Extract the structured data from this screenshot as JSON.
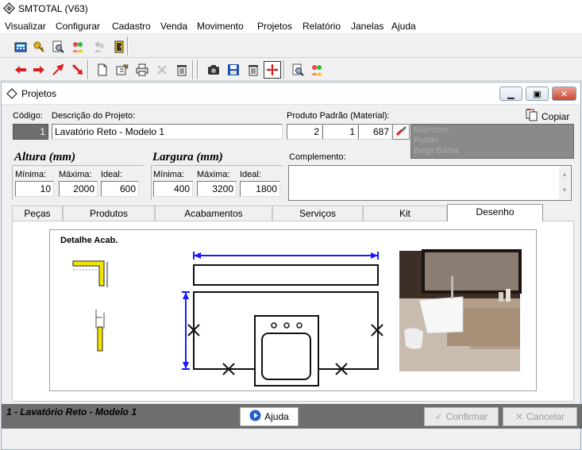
{
  "app": {
    "title": "SMTOTAL (V63)"
  },
  "menu": [
    "Visualizar",
    "Configurar",
    "Cadastro",
    "Venda",
    "Movimento",
    "Projetos",
    "Relatório",
    "Janelas",
    "Ajuda"
  ],
  "window": {
    "title": "Projetos"
  },
  "form": {
    "codigo_label": "Código:",
    "codigo_value": "1",
    "descricao_label": "Descrição do Projeto:",
    "descricao_value": "Lavatório Reto - Modelo 1",
    "produto_label": "Produto Padrão (Material):",
    "produto_v1": "2",
    "produto_v2": "1",
    "produto_v3": "687",
    "copiar_label": "Copiar",
    "materials": [
      "Mármore",
      "Polido",
      "Bege Bahia"
    ],
    "altura_title": "Altura (mm)",
    "largura_title": "Largura (mm)",
    "minima_label": "Mínima:",
    "maxima_label": "Máxima:",
    "ideal_label": "Ideal:",
    "altura_min": "10",
    "altura_max": "2000",
    "altura_ideal": "600",
    "largura_min": "400",
    "largura_max": "3200",
    "largura_ideal": "1800",
    "complemento_label": "Complemento:"
  },
  "tabs": [
    "Peças",
    "Produtos",
    "Acabamentos",
    "Serviços",
    "Kit",
    "Desenho"
  ],
  "drawing": {
    "detail_label": "Detalhe Acab."
  },
  "status": {
    "text": "1 - Lavatório Reto - Modelo 1",
    "ajuda": "Ajuda",
    "confirmar": "Confirmar",
    "cancelar": "Cancelar"
  },
  "colors": {
    "accent": "#1e5fd6",
    "status_bar": "#6e6e6e",
    "drawing_blue": "#1a1aff",
    "detail_yellow": "#f2e600"
  }
}
